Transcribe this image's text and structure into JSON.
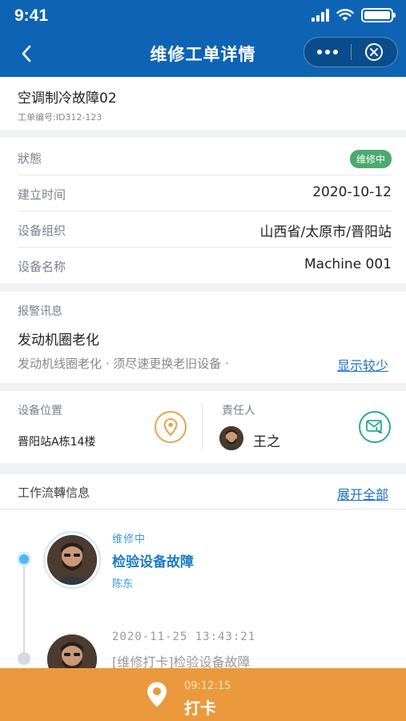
{
  "status_bar": {
    "time": "9:41",
    "battery_level": 1.0
  },
  "header": {
    "title": "维修工单详情",
    "back_icon": "chevron-left-icon",
    "more_icon": "more-dots-icon",
    "close_icon": "close-circle-icon"
  },
  "order": {
    "title": "空调制冷故障02",
    "number": "工单编号:ID312-123"
  },
  "info": {
    "status_label": "狀態",
    "status_value": "维修中",
    "status_color": "#4caa6e",
    "created_label": "建立时间",
    "created_value": "2020-10-12",
    "org_label": "设备组织",
    "org_value": "山西省/太原市/晋阳站",
    "name_label": "设备名称",
    "name_value": "Machine 001"
  },
  "alarm": {
    "label": "报警讯息",
    "title": "发动机圈老化",
    "description": "发动机线圈老化 · 须尽速更换老旧设备 ·",
    "toggle": "显示较少"
  },
  "location": {
    "label": "设备位置",
    "value": "晋阳站A栋14楼",
    "icon": "location-pin-icon",
    "owner_label": "責任人",
    "owner_name": "王之",
    "contact_icon": "phone-mail-icon"
  },
  "workflow": {
    "label": "工作流轉信息",
    "expand": "展开全部",
    "items": [
      {
        "status": "维修中",
        "title": "检验设备故障",
        "person": "陈东"
      },
      {
        "time": "2020-11-25 13:43:21",
        "title": "[维修打卡]检验设备故障"
      }
    ]
  },
  "punch": {
    "time": "09:12:15",
    "label": "打卡",
    "icon": "location-pin-icon"
  },
  "colors": {
    "brand": "#0e63b5",
    "accent": "#ea9a3c",
    "link": "#1a6fcb"
  }
}
